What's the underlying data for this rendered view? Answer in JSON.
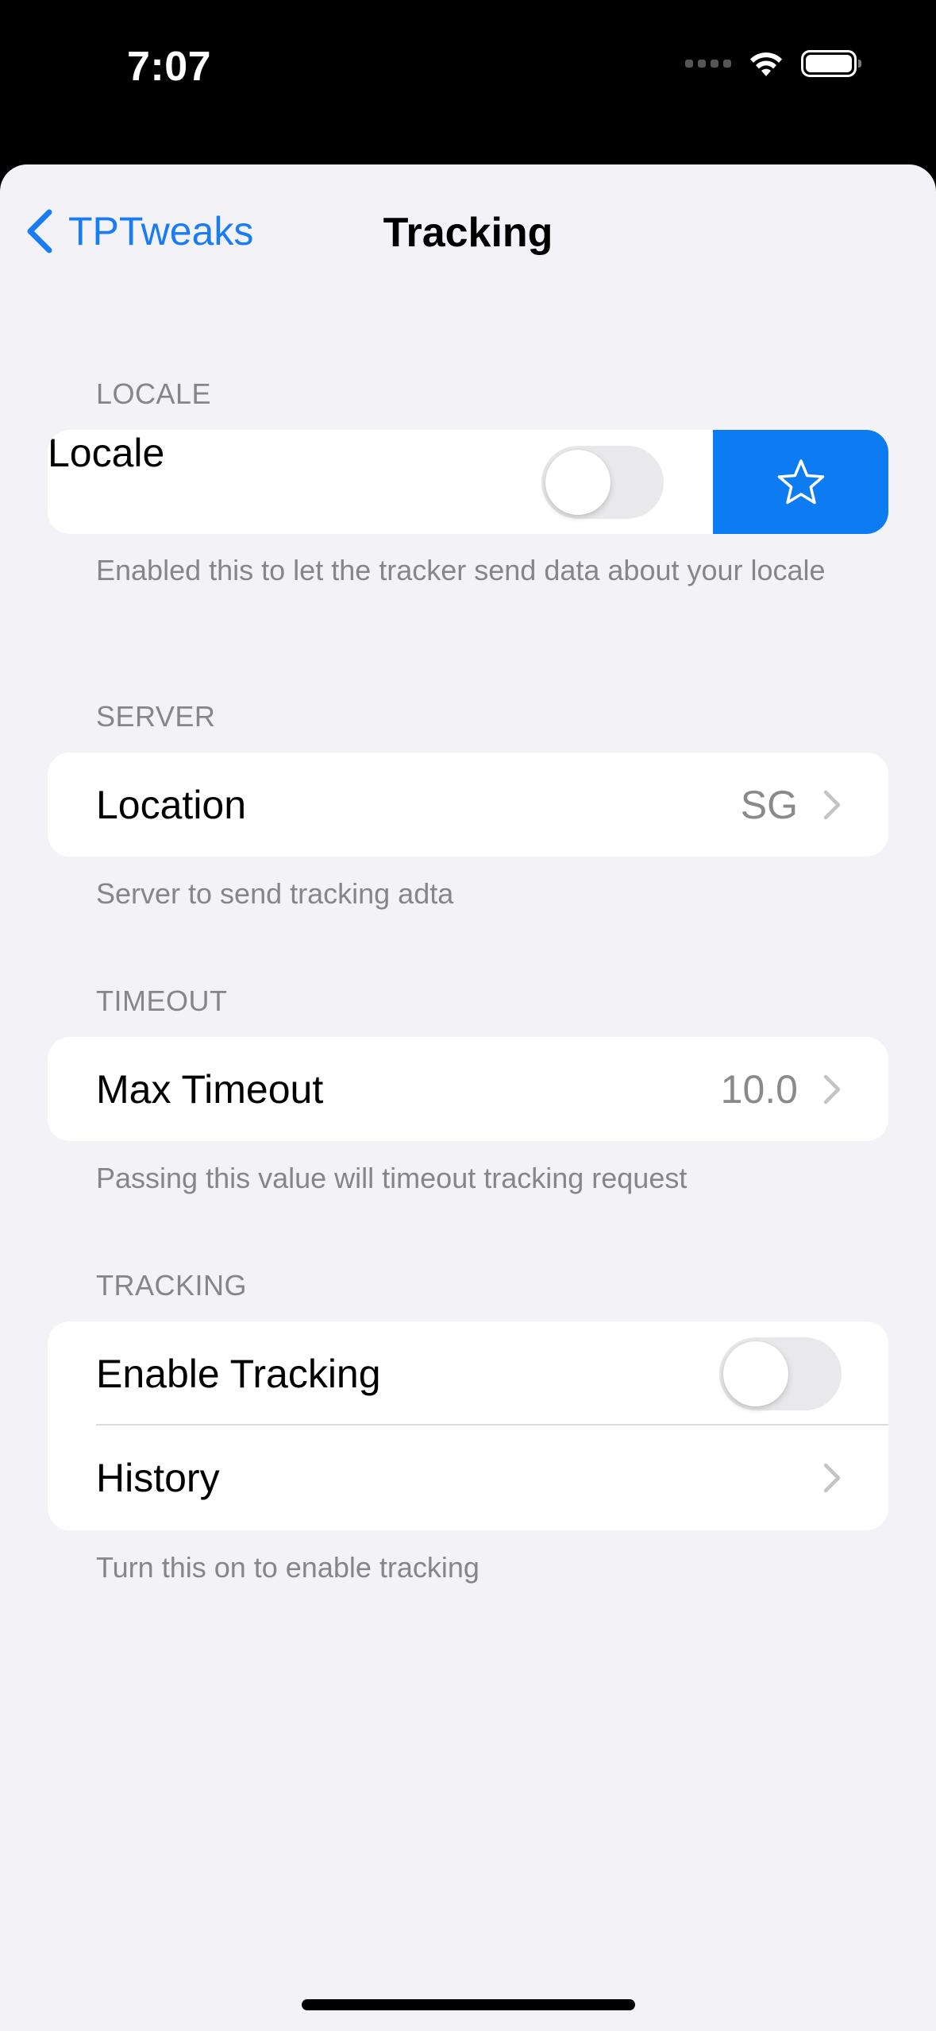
{
  "status": {
    "time": "7:07"
  },
  "nav": {
    "back_label": "TPTweaks",
    "title": "Tracking"
  },
  "sections": [
    {
      "header": "LOCALE",
      "footer": "Enabled this to let the tracker send data about your locale",
      "rows": [
        {
          "label": "Locale",
          "type": "toggle",
          "on": false,
          "swipe_action": "star-icon"
        }
      ]
    },
    {
      "header": "SERVER",
      "footer": "Server to send tracking adta",
      "rows": [
        {
          "label": "Location",
          "type": "disclosure",
          "value": "SG"
        }
      ]
    },
    {
      "header": "TIMEOUT",
      "footer": "Passing this value will timeout tracking request",
      "rows": [
        {
          "label": "Max Timeout",
          "type": "disclosure",
          "value": "10.0"
        }
      ]
    },
    {
      "header": "TRACKING",
      "footer": "Turn this on to enable tracking",
      "rows": [
        {
          "label": "Enable Tracking",
          "type": "toggle",
          "on": false
        },
        {
          "label": "History",
          "type": "disclosure",
          "value": ""
        }
      ]
    }
  ],
  "colors": {
    "accent": "#1a7cf5",
    "swipe_action_bg": "#0d7bf2",
    "background": "#f2f2f7",
    "secondary_text": "#85858a"
  }
}
